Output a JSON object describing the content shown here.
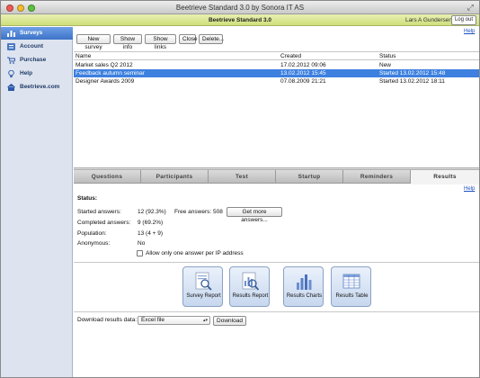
{
  "window": {
    "title": "Beetrieve Standard 3.0 by Sonora IT AS",
    "app_title": "Beetrieve Standard 3.0",
    "user": "Lars A Gundersen",
    "logout_label": "Log out"
  },
  "sidebar": {
    "items": [
      {
        "label": "Surveys",
        "icon": "surveys-icon",
        "active": true
      },
      {
        "label": "Account",
        "icon": "account-icon",
        "active": false
      },
      {
        "label": "Purchase",
        "icon": "cart-icon",
        "active": false
      },
      {
        "label": "Help",
        "icon": "lightbulb-icon",
        "active": false
      },
      {
        "label": "Beetrieve.com",
        "icon": "home-icon",
        "active": false
      }
    ]
  },
  "toolbar": {
    "help_label": "Help",
    "buttons": [
      "New survey",
      "Show info",
      "Show links",
      "Close",
      "Delete..."
    ]
  },
  "survey_list": {
    "columns": [
      "Name",
      "Created",
      "Status"
    ],
    "rows": [
      {
        "name": "Market sales Q2 2012",
        "created": "17.02.2012 09:06",
        "status": "New",
        "selected": false
      },
      {
        "name": "Feedback autumn seminar",
        "created": "13.02.2012 15:45",
        "status": "Started 13.02.2012 15:48",
        "selected": true
      },
      {
        "name": "Designer Awards 2009",
        "created": "07.08.2009 21:21",
        "status": "Started 13.02.2012 18:11",
        "selected": false
      }
    ]
  },
  "tabs": [
    "Questions",
    "Participants",
    "Test",
    "Startup",
    "Reminders",
    "Results"
  ],
  "active_tab": "Results",
  "results": {
    "help_label": "Help",
    "status_label": "Status:",
    "started_label": "Started answers:",
    "started_value": "12 (92.3%)",
    "free_label": "Free answers: 508",
    "get_more_label": "Get more answers...",
    "completed_label": "Completed answers:",
    "completed_value": "9 (69.2%)",
    "population_label": "Population:",
    "population_value": "13 (4 + 9)",
    "anonymous_label": "Anonymous:",
    "anonymous_value": "No",
    "ip_checkbox_label": "Allow only one answer per IP address",
    "ip_checkbox_checked": false,
    "tiles": [
      "Survey Report",
      "Results Report",
      "Results Charts",
      "Results Table"
    ],
    "download_label": "Download results data:",
    "format_selected": "Excel file",
    "download_button": "Download"
  },
  "colors": {
    "selection": "#3d80df",
    "sidebar_active": "#3c72c8",
    "app_bar": "#cfe07a"
  }
}
